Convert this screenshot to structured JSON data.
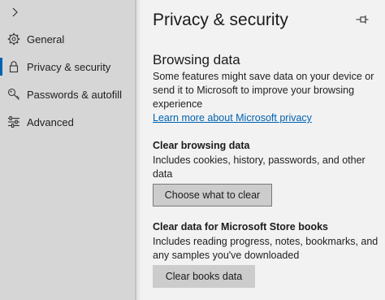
{
  "sidebar": {
    "expand_icon": "chevron-right-icon",
    "items": [
      {
        "label": "General",
        "icon": "gear-icon",
        "active": false
      },
      {
        "label": "Privacy & security",
        "icon": "lock-icon",
        "active": true
      },
      {
        "label": "Passwords & autofill",
        "icon": "key-icon",
        "active": false
      },
      {
        "label": "Advanced",
        "icon": "sliders-icon",
        "active": false
      }
    ]
  },
  "main": {
    "title": "Privacy & security",
    "pin_icon": "pin-icon",
    "browsing_data": {
      "heading": "Browsing data",
      "description": "Some features might save data on your device or send it to Microsoft to improve your browsing experience",
      "link": "Learn more about Microsoft privacy"
    },
    "clear_browsing": {
      "heading": "Clear browsing data",
      "description": "Includes cookies, history, passwords, and other data",
      "button": "Choose what to clear"
    },
    "clear_books": {
      "heading": "Clear data for Microsoft Store books",
      "description": "Includes reading progress, notes, bookmarks, and any samples you've downloaded",
      "button": "Clear books data"
    }
  },
  "colors": {
    "accent": "#0063b1",
    "sidebar_bg": "#d6d6d6",
    "panel_bg": "#f2f2f2",
    "button_bg": "#cccccc"
  }
}
